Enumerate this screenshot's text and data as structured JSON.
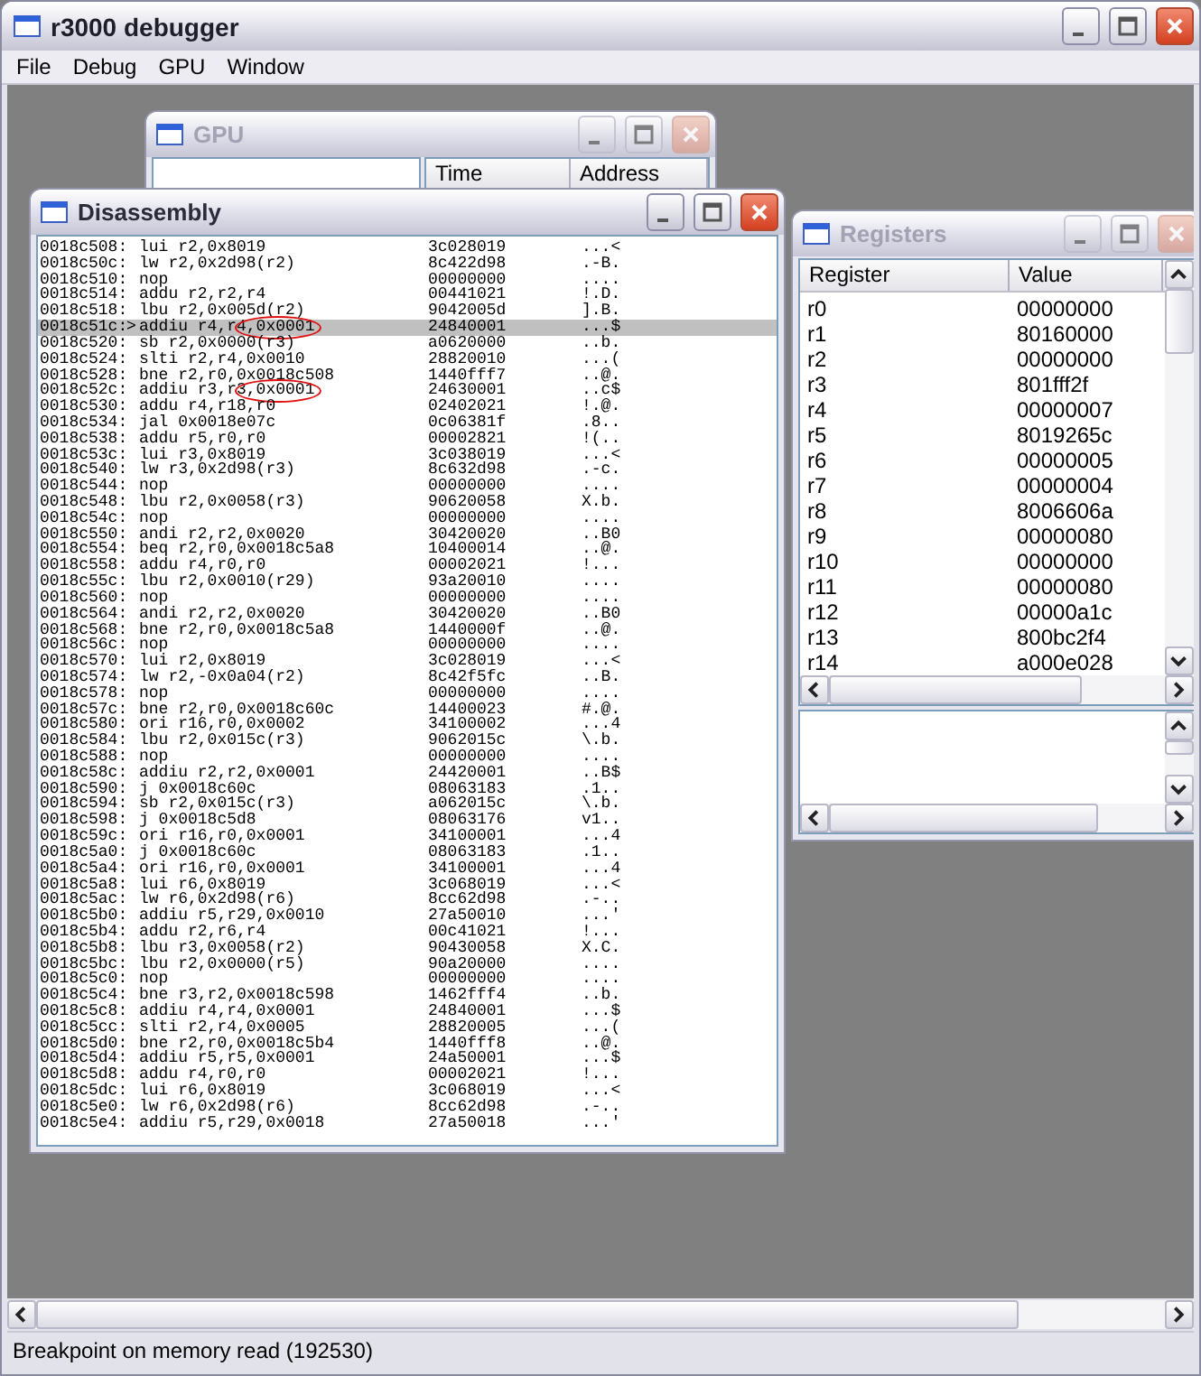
{
  "window": {
    "title": "r3000 debugger",
    "active": true
  },
  "menu": [
    "File",
    "Debug",
    "GPU",
    "Window"
  ],
  "gpu_window": {
    "title": "GPU",
    "active": false,
    "columns": [
      "Time",
      "Address"
    ]
  },
  "disassembly_window": {
    "title": "Disassembly",
    "active": true,
    "rows": [
      {
        "address": "0018c508:",
        "instruction": "lui r2,0x8019",
        "hex": "3c028019",
        "ascii": "...<",
        "selected": false,
        "circled": false
      },
      {
        "address": "0018c50c:",
        "instruction": "lw r2,0x2d98(r2)",
        "hex": "8c422d98",
        "ascii": ".-B.",
        "selected": false,
        "circled": false
      },
      {
        "address": "0018c510:",
        "instruction": "nop",
        "hex": "00000000",
        "ascii": "....",
        "selected": false,
        "circled": false
      },
      {
        "address": "0018c514:",
        "instruction": "addu r2,r2,r4",
        "hex": "00441021",
        "ascii": "!.D.",
        "selected": false,
        "circled": false
      },
      {
        "address": "0018c518:",
        "instruction": "lbu r2,0x005d(r2)",
        "hex": "9042005d",
        "ascii": "].B.",
        "selected": false,
        "circled": false
      },
      {
        "address": "0018c51c:",
        "marker": ">",
        "instruction": "addiu r4,r4,0x0001",
        "hex": "24840001",
        "ascii": "...$",
        "selected": true,
        "circled": true
      },
      {
        "address": "0018c520:",
        "instruction": "sb r2,0x0000(r3)",
        "hex": "a0620000",
        "ascii": "..b.",
        "selected": false,
        "circled": false
      },
      {
        "address": "0018c524:",
        "instruction": "slti r2,r4,0x0010",
        "hex": "28820010",
        "ascii": "...(",
        "selected": false,
        "circled": false
      },
      {
        "address": "0018c528:",
        "instruction": "bne r2,r0,0x0018c508",
        "hex": "1440fff7",
        "ascii": "..@.",
        "selected": false,
        "circled": false
      },
      {
        "address": "0018c52c:",
        "instruction": "addiu r3,r3,0x0001",
        "hex": "24630001",
        "ascii": "..c$",
        "selected": false,
        "circled": true
      },
      {
        "address": "0018c530:",
        "instruction": "addu r4,r18,r0",
        "hex": "02402021",
        "ascii": "!.@.",
        "selected": false,
        "circled": false
      },
      {
        "address": "0018c534:",
        "instruction": "jal 0x0018e07c",
        "hex": "0c06381f",
        "ascii": ".8..",
        "selected": false,
        "circled": false
      },
      {
        "address": "0018c538:",
        "instruction": "addu r5,r0,r0",
        "hex": "00002821",
        "ascii": "!(..",
        "selected": false,
        "circled": false
      },
      {
        "address": "0018c53c:",
        "instruction": "lui r3,0x8019",
        "hex": "3c038019",
        "ascii": "...<",
        "selected": false,
        "circled": false
      },
      {
        "address": "0018c540:",
        "instruction": "lw r3,0x2d98(r3)",
        "hex": "8c632d98",
        "ascii": ".-c.",
        "selected": false,
        "circled": false
      },
      {
        "address": "0018c544:",
        "instruction": "nop",
        "hex": "00000000",
        "ascii": "....",
        "selected": false,
        "circled": false
      },
      {
        "address": "0018c548:",
        "instruction": "lbu r2,0x0058(r3)",
        "hex": "90620058",
        "ascii": "X.b.",
        "selected": false,
        "circled": false
      },
      {
        "address": "0018c54c:",
        "instruction": "nop",
        "hex": "00000000",
        "ascii": "....",
        "selected": false,
        "circled": false
      },
      {
        "address": "0018c550:",
        "instruction": "andi r2,r2,0x0020",
        "hex": "30420020",
        "ascii": "..B0",
        "selected": false,
        "circled": false
      },
      {
        "address": "0018c554:",
        "instruction": "beq r2,r0,0x0018c5a8",
        "hex": "10400014",
        "ascii": "..@.",
        "selected": false,
        "circled": false
      },
      {
        "address": "0018c558:",
        "instruction": "addu r4,r0,r0",
        "hex": "00002021",
        "ascii": "!...",
        "selected": false,
        "circled": false
      },
      {
        "address": "0018c55c:",
        "instruction": "lbu r2,0x0010(r29)",
        "hex": "93a20010",
        "ascii": "....",
        "selected": false,
        "circled": false
      },
      {
        "address": "0018c560:",
        "instruction": "nop",
        "hex": "00000000",
        "ascii": "....",
        "selected": false,
        "circled": false
      },
      {
        "address": "0018c564:",
        "instruction": "andi r2,r2,0x0020",
        "hex": "30420020",
        "ascii": "..B0",
        "selected": false,
        "circled": false
      },
      {
        "address": "0018c568:",
        "instruction": "bne r2,r0,0x0018c5a8",
        "hex": "1440000f",
        "ascii": "..@.",
        "selected": false,
        "circled": false
      },
      {
        "address": "0018c56c:",
        "instruction": "nop",
        "hex": "00000000",
        "ascii": "....",
        "selected": false,
        "circled": false
      },
      {
        "address": "0018c570:",
        "instruction": "lui r2,0x8019",
        "hex": "3c028019",
        "ascii": "...<",
        "selected": false,
        "circled": false
      },
      {
        "address": "0018c574:",
        "instruction": "lw r2,-0x0a04(r2)",
        "hex": "8c42f5fc",
        "ascii": "..B.",
        "selected": false,
        "circled": false
      },
      {
        "address": "0018c578:",
        "instruction": "nop",
        "hex": "00000000",
        "ascii": "....",
        "selected": false,
        "circled": false
      },
      {
        "address": "0018c57c:",
        "instruction": "bne r2,r0,0x0018c60c",
        "hex": "14400023",
        "ascii": "#.@.",
        "selected": false,
        "circled": false
      },
      {
        "address": "0018c580:",
        "instruction": "ori r16,r0,0x0002",
        "hex": "34100002",
        "ascii": "...4",
        "selected": false,
        "circled": false
      },
      {
        "address": "0018c584:",
        "instruction": "lbu r2,0x015c(r3)",
        "hex": "9062015c",
        "ascii": "\\.b.",
        "selected": false,
        "circled": false
      },
      {
        "address": "0018c588:",
        "instruction": "nop",
        "hex": "00000000",
        "ascii": "....",
        "selected": false,
        "circled": false
      },
      {
        "address": "0018c58c:",
        "instruction": "addiu r2,r2,0x0001",
        "hex": "24420001",
        "ascii": "..B$",
        "selected": false,
        "circled": false
      },
      {
        "address": "0018c590:",
        "instruction": "j 0x0018c60c",
        "hex": "08063183",
        "ascii": ".1..",
        "selected": false,
        "circled": false
      },
      {
        "address": "0018c594:",
        "instruction": "sb r2,0x015c(r3)",
        "hex": "a062015c",
        "ascii": "\\.b.",
        "selected": false,
        "circled": false
      },
      {
        "address": "0018c598:",
        "instruction": "j 0x0018c5d8",
        "hex": "08063176",
        "ascii": "v1..",
        "selected": false,
        "circled": false
      },
      {
        "address": "0018c59c:",
        "instruction": "ori r16,r0,0x0001",
        "hex": "34100001",
        "ascii": "...4",
        "selected": false,
        "circled": false
      },
      {
        "address": "0018c5a0:",
        "instruction": "j 0x0018c60c",
        "hex": "08063183",
        "ascii": ".1..",
        "selected": false,
        "circled": false
      },
      {
        "address": "0018c5a4:",
        "instruction": "ori r16,r0,0x0001",
        "hex": "34100001",
        "ascii": "...4",
        "selected": false,
        "circled": false
      },
      {
        "address": "0018c5a8:",
        "instruction": "lui r6,0x8019",
        "hex": "3c068019",
        "ascii": "...<",
        "selected": false,
        "circled": false
      },
      {
        "address": "0018c5ac:",
        "instruction": "lw r6,0x2d98(r6)",
        "hex": "8cc62d98",
        "ascii": ".-..",
        "selected": false,
        "circled": false
      },
      {
        "address": "0018c5b0:",
        "instruction": "addiu r5,r29,0x0010",
        "hex": "27a50010",
        "ascii": "...'",
        "selected": false,
        "circled": false
      },
      {
        "address": "0018c5b4:",
        "instruction": "addu r2,r6,r4",
        "hex": "00c41021",
        "ascii": "!...",
        "selected": false,
        "circled": false
      },
      {
        "address": "0018c5b8:",
        "instruction": "lbu r3,0x0058(r2)",
        "hex": "90430058",
        "ascii": "X.C.",
        "selected": false,
        "circled": false
      },
      {
        "address": "0018c5bc:",
        "instruction": "lbu r2,0x0000(r5)",
        "hex": "90a20000",
        "ascii": "....",
        "selected": false,
        "circled": false
      },
      {
        "address": "0018c5c0:",
        "instruction": "nop",
        "hex": "00000000",
        "ascii": "....",
        "selected": false,
        "circled": false
      },
      {
        "address": "0018c5c4:",
        "instruction": "bne r3,r2,0x0018c598",
        "hex": "1462fff4",
        "ascii": "..b.",
        "selected": false,
        "circled": false
      },
      {
        "address": "0018c5c8:",
        "instruction": "addiu r4,r4,0x0001",
        "hex": "24840001",
        "ascii": "...$",
        "selected": false,
        "circled": false
      },
      {
        "address": "0018c5cc:",
        "instruction": "slti r2,r4,0x0005",
        "hex": "28820005",
        "ascii": "...(",
        "selected": false,
        "circled": false
      },
      {
        "address": "0018c5d0:",
        "instruction": "bne r2,r0,0x0018c5b4",
        "hex": "1440fff8",
        "ascii": "..@.",
        "selected": false,
        "circled": false
      },
      {
        "address": "0018c5d4:",
        "instruction": "addiu r5,r5,0x0001",
        "hex": "24a50001",
        "ascii": "...$",
        "selected": false,
        "circled": false
      },
      {
        "address": "0018c5d8:",
        "instruction": "addu r4,r0,r0",
        "hex": "00002021",
        "ascii": "!...",
        "selected": false,
        "circled": false
      },
      {
        "address": "0018c5dc:",
        "instruction": "lui r6,0x8019",
        "hex": "3c068019",
        "ascii": "...<",
        "selected": false,
        "circled": false
      },
      {
        "address": "0018c5e0:",
        "instruction": "lw r6,0x2d98(r6)",
        "hex": "8cc62d98",
        "ascii": ".-..",
        "selected": false,
        "circled": false
      },
      {
        "address": "0018c5e4:",
        "instruction": "addiu r5,r29,0x0018",
        "hex": "27a50018",
        "ascii": "...'",
        "selected": false,
        "circled": false
      }
    ]
  },
  "registers_window": {
    "title": "Registers",
    "active": false,
    "columns": [
      "Register",
      "Value"
    ],
    "rows": [
      {
        "register": "r0",
        "value": "00000000"
      },
      {
        "register": "r1",
        "value": "80160000"
      },
      {
        "register": "r2",
        "value": "00000000"
      },
      {
        "register": "r3",
        "value": "801fff2f"
      },
      {
        "register": "r4",
        "value": "00000007"
      },
      {
        "register": "r5",
        "value": "8019265c"
      },
      {
        "register": "r6",
        "value": "00000005"
      },
      {
        "register": "r7",
        "value": "00000004"
      },
      {
        "register": "r8",
        "value": "8006606a"
      },
      {
        "register": "r9",
        "value": "00000080"
      },
      {
        "register": "r10",
        "value": "00000000"
      },
      {
        "register": "r11",
        "value": "00000080"
      },
      {
        "register": "r12",
        "value": "00000a1c"
      },
      {
        "register": "r13",
        "value": "800bc2f4"
      },
      {
        "register": "r14",
        "value": "a000e028"
      }
    ]
  },
  "status_bar": "Breakpoint on memory read (192530)"
}
